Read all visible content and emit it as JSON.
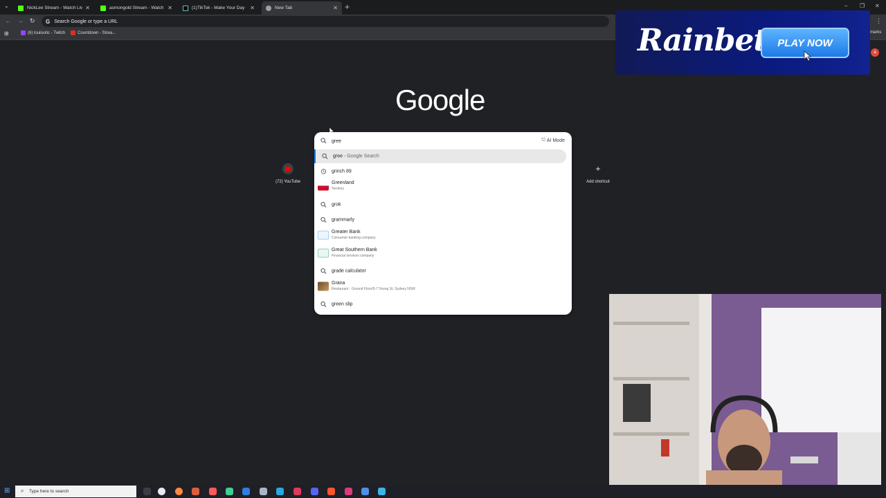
{
  "tabs": [
    {
      "title": "NickLee Stream - Watch Live or",
      "favicon_color": "#53fc18",
      "active": false
    },
    {
      "title": "asmongold Stream - Watch Liv",
      "favicon_color": "#53fc18",
      "active": false
    },
    {
      "title": "(1)TikTok - Make Your Day",
      "favicon_color": "#000000",
      "active": false
    },
    {
      "title": "New Tab",
      "favicon_color": "#9aa0a6",
      "active": true
    }
  ],
  "omnibox": {
    "placeholder": "Search Google or type a URL"
  },
  "bookmarks": [
    {
      "label": "(6) louiisotic - Twitch",
      "icon_color": "#9146ff"
    },
    {
      "label": "Countdown - Strea...",
      "icon_color": "#d93025"
    }
  ],
  "bookmarks_right": "marks",
  "google_logo": "Google",
  "shortcuts": [
    {
      "label": "(72) YouTube",
      "icon": "youtube-icon"
    },
    {
      "label": "Add shortcut",
      "icon": "plus-icon"
    }
  ],
  "search": {
    "value": "gree",
    "ai_mode_label": "AI Mode",
    "suggestions": [
      {
        "text": "gree",
        "suffix": "- Google Search",
        "icon": "search-icon",
        "selected": true
      },
      {
        "text": "grinch 89",
        "icon": "history-icon"
      },
      {
        "text": "Greenland",
        "sub": "Territory",
        "icon": "flag-thumbnail"
      },
      {
        "text": "grok",
        "icon": "search-icon"
      },
      {
        "text": "grammarly",
        "icon": "search-icon"
      },
      {
        "text": "Greater Bank",
        "sub": "Consumer banking company",
        "icon": "bank-logo-thumbnail"
      },
      {
        "text": "Great Southern Bank",
        "sub": "Financial services company",
        "icon": "bank-logo-thumbnail"
      },
      {
        "text": "grade calculator",
        "icon": "search-icon"
      },
      {
        "text": "Grana",
        "sub": "Restaurant · Ground Floor/5-7 Young St, Sydney NSW",
        "icon": "restaurant-thumbnail"
      },
      {
        "text": "green slip",
        "icon": "search-icon"
      }
    ]
  },
  "ad": {
    "brand": "Rainbet",
    "cta": "PLAY NOW",
    "badge": "a"
  },
  "taskbar": {
    "search_placeholder": "Type here to search"
  },
  "colors": {
    "page_bg": "#202124",
    "panel_bg": "#ffffff",
    "selection_accent": "#1a73e8",
    "ad_bg": "#0b1a7e"
  }
}
